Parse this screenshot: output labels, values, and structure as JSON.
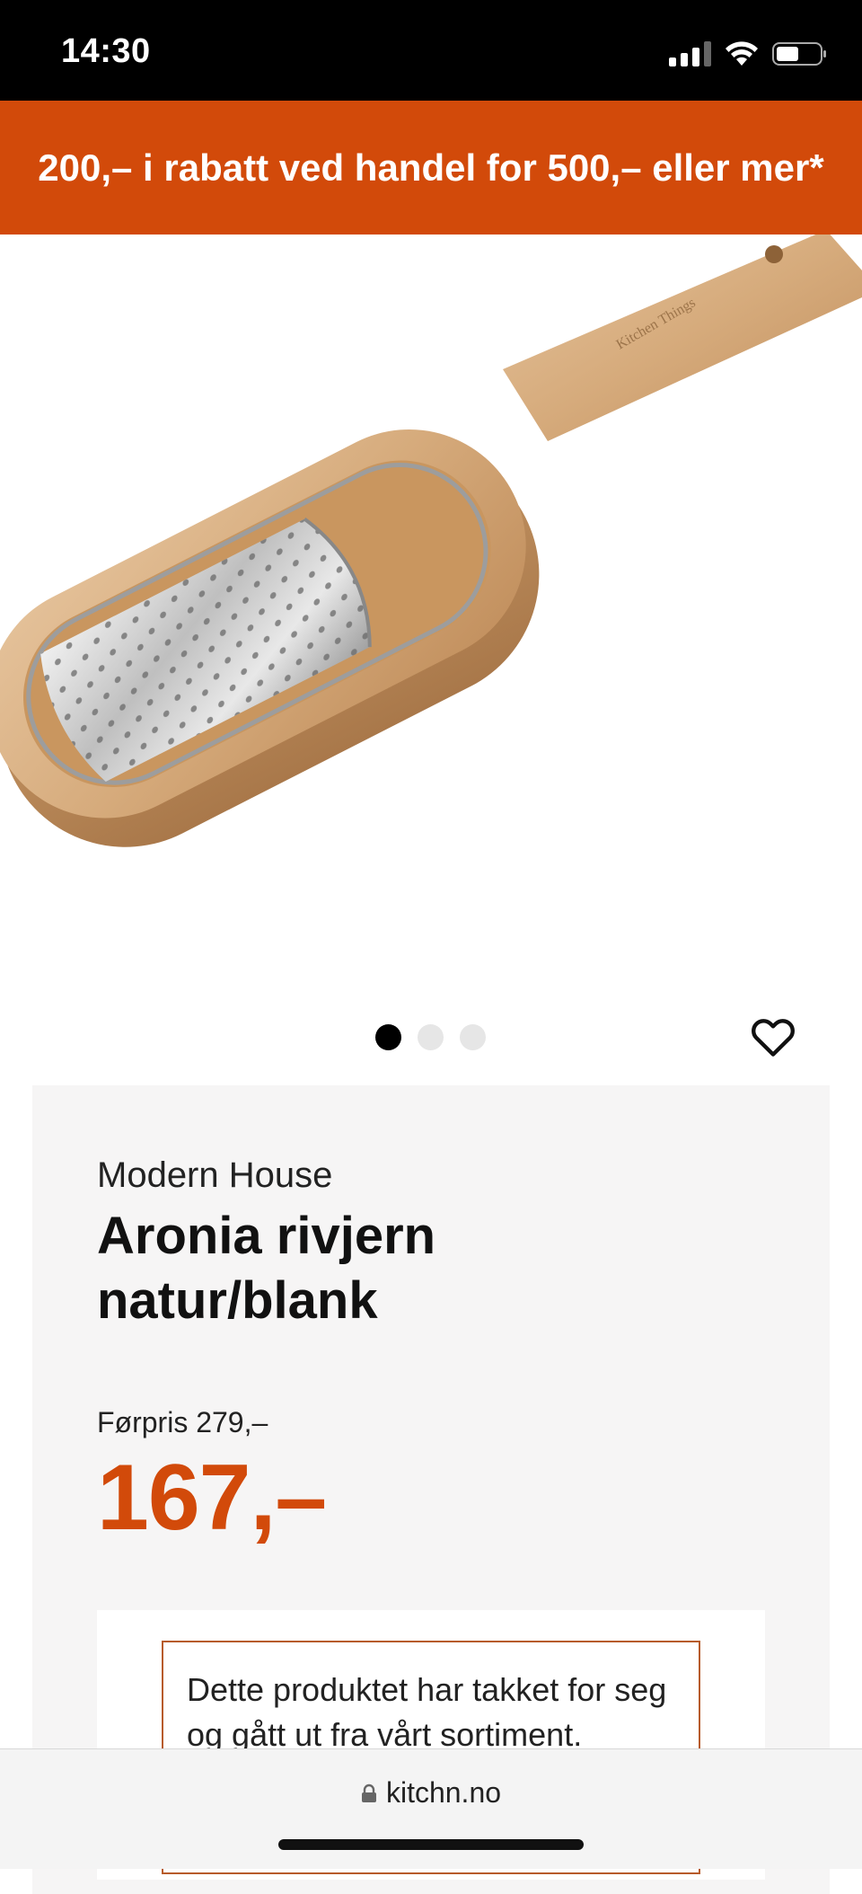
{
  "status": {
    "time": "14:30"
  },
  "promo_banner": {
    "text": "200,– i rabatt ved handel for 500,– eller mer*"
  },
  "product": {
    "image_logo_text": "Kitchen Things",
    "brand": "Modern House",
    "title": "Aronia rivjern natur/blank",
    "pre_price": "Førpris 279,–",
    "price": "167,–",
    "carousel": {
      "total": 3,
      "active_index": 0
    },
    "notice": "Dette produktet har takket for seg og gått ut fra vårt sortiment."
  },
  "browser": {
    "url": "kitchn.no"
  },
  "colors": {
    "accent": "#d24a0a",
    "card_bg": "#f6f5f5",
    "notice_border": "#b75b2a"
  },
  "icons": [
    "signal-icon",
    "wifi-icon",
    "battery-icon",
    "heart-icon",
    "lock-icon"
  ]
}
